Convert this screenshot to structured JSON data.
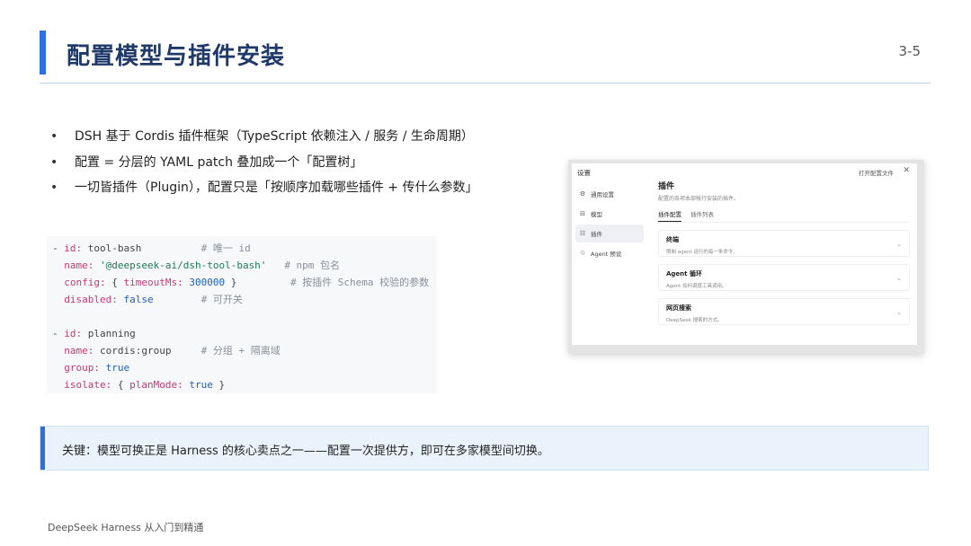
{
  "header": {
    "title": "配置模型与插件安装",
    "page": "3-5"
  },
  "bullets": [
    "DSH 基于 Cordis 插件框架（TypeScript 依赖注入 / 服务 / 生命周期）",
    "配置 = 分层的 YAML patch 叠加成一个「配置树」",
    "一切皆插件（Plugin），配置只是「按顺序加载哪些插件 + 传什么参数」"
  ],
  "code": {
    "b1_dash": "- ",
    "b1_id_key": "id:",
    "b1_id_val": " tool-bash",
    "b1_id_comment": "# 唯一 id",
    "b1_name_key": "name:",
    "b1_name_val": " '@deepseek-ai/dsh-tool-bash'",
    "b1_name_comment": "# npm 包名",
    "b1_config_key": "config:",
    "b1_config_open": " { ",
    "b1_timeout_key": "timeoutMs:",
    "b1_timeout_val": " 300000",
    "b1_config_close": " }",
    "b1_config_comment": "# 按插件 Schema 校验的参数",
    "b1_disabled_key": "disabled:",
    "b1_disabled_val": " false",
    "b1_disabled_comment": "# 可开关",
    "b2_dash": "- ",
    "b2_id_key": "id:",
    "b2_id_val": " planning",
    "b2_name_key": "name:",
    "b2_name_val": " cordis:group",
    "b2_name_comment": "# 分组 + 隔离域",
    "b2_group_key": "group:",
    "b2_group_val": " true",
    "b2_isolate_key": "isolate:",
    "b2_isolate_open": " { ",
    "b2_plan_key": "planMode:",
    "b2_plan_val": " true",
    "b2_isolate_close": " }"
  },
  "settings": {
    "window_title": "设置",
    "open_config": "打开配置文件",
    "close_glyph": "✕",
    "nav": [
      {
        "icon": "⚙",
        "label": "通用设置"
      },
      {
        "icon": "⊟",
        "label": "模型"
      },
      {
        "icon": "☷",
        "label": "插件"
      },
      {
        "icon": "♲",
        "label": "Agent 预设"
      }
    ],
    "pane_title": "插件",
    "pane_sub": "配置的各项本部帐行安装的插件。",
    "tabs": [
      "插件配置",
      "插件列表"
    ],
    "cards": [
      {
        "title": "终端",
        "sub": "限制 agent 运行的每一条命令。"
      },
      {
        "title": "Agent 循环",
        "sub": "Agent 如何调度工具调用。"
      },
      {
        "title": "网页搜索",
        "sub": "DeepSeek 搜索的方式。"
      }
    ],
    "chevron": "⌄"
  },
  "callout": {
    "text": "关键：模型可换正是 Harness 的核心卖点之一——配置一次提供方，即可在多家模型间切换。"
  },
  "footer": "DeepSeek Harness 从入门到精通",
  "colors": {
    "accent": "#2f6fe0",
    "title": "#1f3a68",
    "callout_bg": "#eaf3fc"
  }
}
